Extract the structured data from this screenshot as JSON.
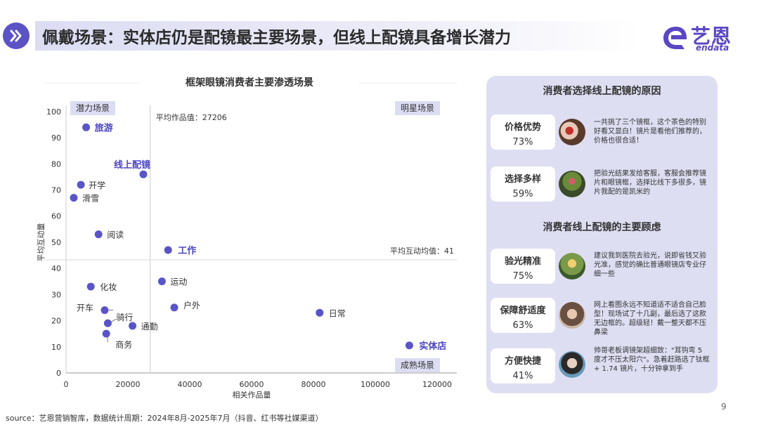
{
  "header": {
    "title": "佩戴场景：实体店仍是配镜最主要场景，但线上配镜具备增长潜力"
  },
  "logo": {
    "text": "艺恩",
    "sub": "endata"
  },
  "colors": {
    "accent": "#5b52c4",
    "panel": "#dedef3",
    "dot": "#5a55c6"
  },
  "chart_data": {
    "type": "scatter",
    "title": "框架眼镜消费者主要渗透场景",
    "xlabel": "相关作品量",
    "ylabel": "平均互动量",
    "xlim": [
      0,
      120000
    ],
    "xticks": [
      0,
      20000,
      40000,
      60000,
      80000,
      100000,
      120000
    ],
    "ylim_top": [
      40,
      100
    ],
    "yticks_top": [
      50,
      60,
      70,
      80,
      90,
      100
    ],
    "ylim_bottom": [
      0,
      40
    ],
    "yticks_bottom": [
      0,
      10,
      20,
      30,
      40
    ],
    "x_avg": 27206,
    "y_avg": 41,
    "x_avg_label": "平均作品值：27206",
    "y_avg_label": "平均互动均值：41",
    "quadrants": {
      "top_left": "潜力场景",
      "top_right": "明星场景",
      "bottom_right": "成熟场景"
    },
    "points": [
      {
        "name": "旅游",
        "x": 6500,
        "y": 94,
        "highlight": true
      },
      {
        "name": "线上配镜",
        "x": 25000,
        "y": 76,
        "highlight": true
      },
      {
        "name": "开学",
        "x": 4800,
        "y": 72,
        "highlight": false
      },
      {
        "name": "滑雪",
        "x": 2500,
        "y": 67,
        "highlight": false
      },
      {
        "name": "阅读",
        "x": 10500,
        "y": 53,
        "highlight": false
      },
      {
        "name": "工作",
        "x": 33000,
        "y": 47,
        "highlight": true
      },
      {
        "name": "化妆",
        "x": 8000,
        "y": 33,
        "highlight": false
      },
      {
        "name": "运动",
        "x": 31000,
        "y": 35,
        "highlight": false
      },
      {
        "name": "开车",
        "x": 12500,
        "y": 24,
        "highlight": false
      },
      {
        "name": "户外",
        "x": 35000,
        "y": 25,
        "highlight": false
      },
      {
        "name": "日常",
        "x": 82000,
        "y": 23,
        "highlight": false
      },
      {
        "name": "骑行",
        "x": 13500,
        "y": 19,
        "highlight": false
      },
      {
        "name": "通勤",
        "x": 21500,
        "y": 18,
        "highlight": false
      },
      {
        "name": "商务",
        "x": 13000,
        "y": 15,
        "highlight": false
      },
      {
        "name": "实体店",
        "x": 111000,
        "y": 10.5,
        "highlight": true
      }
    ]
  },
  "panel": {
    "reasons_title": "消费者选择线上配镜的原因",
    "concerns_title": "消费者线上配镜的主要顾虑",
    "reasons": [
      {
        "label": "价格优势",
        "pct": "73%",
        "quote": "一共挑了三个镜框，这个茶色的特别好看又显白！镜片是看他们推荐的，价格也很合适！"
      },
      {
        "label": "选择多样",
        "pct": "59%",
        "quote": "把验光结果发给客服，客服会推荐镜片和眼镜框，选择比线下多很多，镜片我配的是凯米的"
      }
    ],
    "concerns": [
      {
        "label": "验光精准",
        "pct": "75%",
        "quote": "建议我到医院去验光，说即省钱又验光准，感觉的确比普通眼镜店专业仔细一些"
      },
      {
        "label": "保障舒适度",
        "pct": "63%",
        "quote": "网上看图永远不知道适不适合自己脸型！现场试了十几副，最后选了这款无边框的。超级轻！戴一整天都不压鼻梁"
      },
      {
        "label": "方便快捷",
        "pct": "41%",
        "quote": "帅哥老板调镜架超细致：\"耳钩弯 5 度才不压太阳穴\"。急着赶路选了钛框 + 1.74 镜片，十分钟拿到手"
      }
    ]
  },
  "footer": {
    "source": "source：艺恩营销智库，数据统计周期：2024年8月-2025年7月（抖音、红书等社媒渠道）",
    "page": "9"
  }
}
